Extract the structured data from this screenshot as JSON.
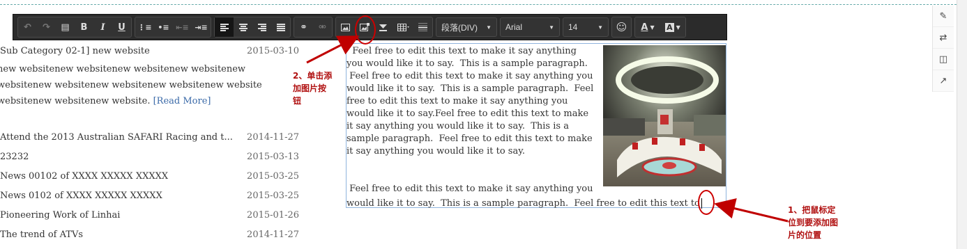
{
  "toolbar": {
    "paragraph_label": "段落(DIV)",
    "font_label": "Arial",
    "size_label": "14",
    "icons": [
      "undo-icon",
      "redo-icon",
      "source-icon",
      "bold",
      "italic",
      "underline",
      "ordered-list",
      "unordered-list",
      "outdent",
      "indent",
      "align-left",
      "align-center",
      "align-right",
      "justify",
      "link",
      "unlink",
      "image",
      "image-manager",
      "insert-below",
      "table",
      "horizontal-rule",
      "paragraph",
      "font",
      "size",
      "emoji",
      "font-color",
      "background-color"
    ]
  },
  "list": {
    "first_title": "Sub Category 02-1] new website",
    "first_date": "2015-03-10",
    "first_body_lines": [
      "new websitenew websitenew websitenew websitenew",
      "websitenew websitenew websitenew websitenew website",
      "websitenew websitenew website."
    ],
    "read_more": "[Read More]",
    "items": [
      {
        "title": "Attend the 2013 Australian SAFARI Racing and t...",
        "date": "2014-11-27"
      },
      {
        "title": "23232",
        "date": "2015-03-13"
      },
      {
        "title": "News 00102 of XXXX XXXXX XXXXX",
        "date": "2015-03-25"
      },
      {
        "title": "News 0102 of XXXX XXXXX XXXXX",
        "date": "2015-03-25"
      },
      {
        "title": "Pioneering Work of Linhai",
        "date": "2015-01-26"
      },
      {
        "title": "The trend of ATVs",
        "date": "2014-11-27"
      }
    ]
  },
  "editor": {
    "lines": [
      "  Feel free to edit this text to make it say anything",
      "you would like it to say.  This is a sample paragraph.",
      " Feel free to edit this text to make it say anything you",
      "would like it to say.  This is a sample paragraph.  Feel",
      "free to edit this text to make it say anything you",
      "would like it to say.Feel free to edit this text to make",
      "it say anything you would like it to say.  This is a",
      "sample paragraph.  Feel free to edit this text to make",
      "it say anything you would like it to say."
    ],
    "para2_line1": " Feel free to edit this text to make it say anything you",
    "para2_line2": "would like it to say.  This is a sample paragraph.  Feel free to edit this text to"
  },
  "annotations": {
    "step2": [
      "2、单击添",
      "加图片按",
      "钮"
    ],
    "step1": [
      "1、把鼠标定",
      "位到要添加图",
      "片的位置"
    ],
    "accent_color": "#c00000"
  }
}
